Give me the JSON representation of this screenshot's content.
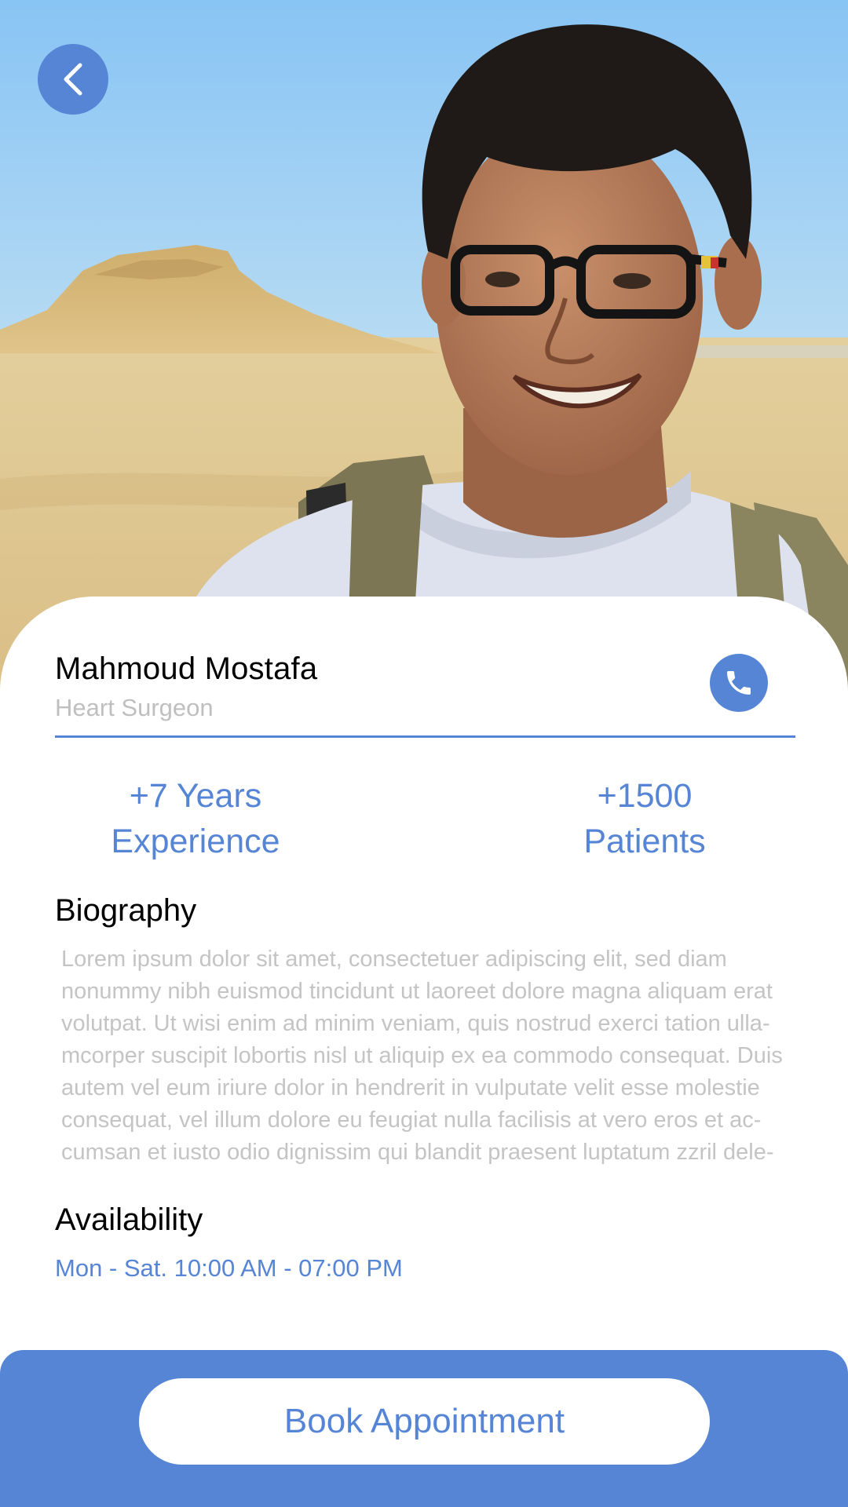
{
  "header": {
    "back_icon": "chevron-left-icon"
  },
  "doctor": {
    "name": "Mahmoud Mostafa",
    "role": "Heart Surgeon",
    "call_icon": "phone-icon"
  },
  "stats": {
    "experience_line1": "+7 Years",
    "experience_line2": "Experience",
    "patients_line1": "+1500",
    "patients_line2": "Patients"
  },
  "biography": {
    "title": "Biography",
    "lines": [
      "Lorem ipsum dolor sit amet, consectetuer adipiscing elit, sed diam",
      "nonummy nibh euismod tincidunt ut laoreet dolore magna aliquam erat",
      "volutpat. Ut wisi enim ad minim veniam, quis nostrud exerci tation ulla-",
      "mcorper suscipit lobortis nisl ut aliquip ex ea commodo consequat. Duis",
      "autem vel eum iriure dolor in hendrerit in vulputate velit esse molestie",
      "consequat, vel illum dolore eu feugiat nulla facilisis at vero eros et ac-",
      "cumsan et iusto odio dignissim qui blandit praesent luptatum zzril dele-"
    ]
  },
  "availability": {
    "title": "Availability",
    "hours": "Mon - Sat. 10:00 AM - 07:00 PM"
  },
  "actions": {
    "book_label": "Book Appointment"
  },
  "colors": {
    "accent": "#5685d6",
    "muted_text": "#c4c4c4",
    "subtitle_text": "#bfbfbf",
    "sky": "#8ec8f6",
    "sand": "#e2c98f"
  }
}
